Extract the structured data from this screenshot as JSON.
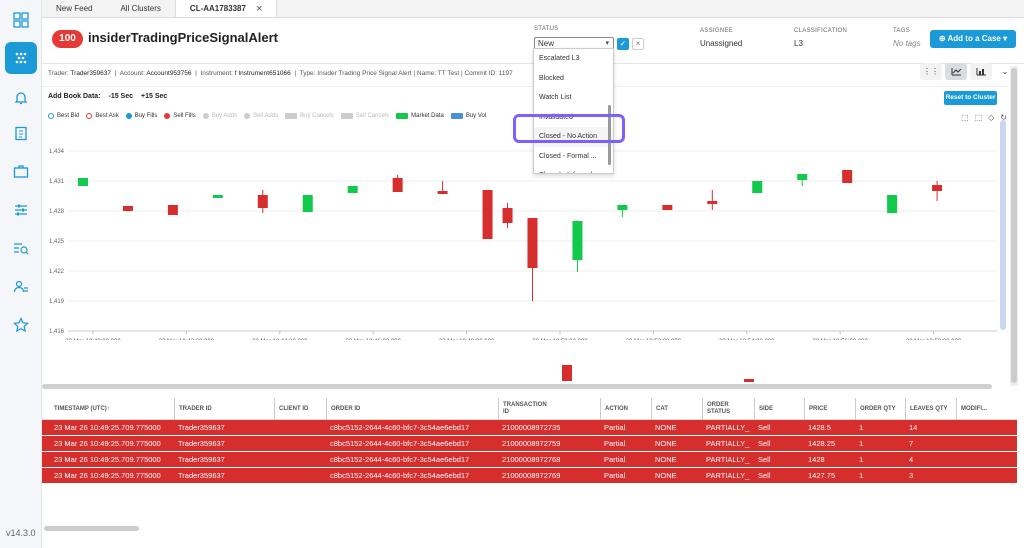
{
  "tabs": [
    {
      "label": "New Feed"
    },
    {
      "label": "All Clusters"
    },
    {
      "label": "CL-AA1783387"
    }
  ],
  "sidebar": {
    "version": "v14.3.0"
  },
  "header": {
    "score": "100",
    "title": "insiderTradingPriceSignalAlert",
    "status_label": "STATUS",
    "status_value": "New",
    "assignee_label": "ASSIGNEE",
    "assignee_value": "Unassigned",
    "classification_label": "CLASSIFICATION",
    "classification_value": "L3",
    "tags_label": "TAGS",
    "tags_value": "No tags",
    "add_case": "Add to a Case"
  },
  "status_dropdown": {
    "options": [
      "Escalated L3",
      "Blocked",
      "Watch List",
      "Invalidated",
      "Closed - No Action",
      "Closed - Formal ...",
      "Closed - Informal..."
    ],
    "highlighted": "Closed - No Action"
  },
  "info": {
    "trader_label": "Trader:",
    "trader": "Trader359637",
    "account_label": "Account:",
    "account": "Account953756",
    "instrument_label": "Instrument:",
    "instrument": "f Instrument651066",
    "rest": "Type: Insider Trading Price Signal Alert | Name: TT Test | Commit ID: 1197"
  },
  "chart_controls": {
    "book_label": "Add Book Data:",
    "minus": "-15 Sec",
    "plus": "+15 Sec",
    "reset": "Reset to Cluster"
  },
  "legend": [
    {
      "label": "Best Bid",
      "color": "#1a9ad6",
      "kind": "ring",
      "dim": false
    },
    {
      "label": "Best Ask",
      "color": "#e53935",
      "kind": "ring",
      "dim": false
    },
    {
      "label": "Buy Fills",
      "color": "#1a9ad6",
      "kind": "dot",
      "dim": false
    },
    {
      "label": "Sell Fills",
      "color": "#e53935",
      "kind": "dot",
      "dim": false
    },
    {
      "label": "Buy Adds",
      "color": "#cccccc",
      "kind": "dot",
      "dim": true
    },
    {
      "label": "Sell Adds",
      "color": "#cccccc",
      "kind": "dot",
      "dim": true
    },
    {
      "label": "Buy Cancels",
      "color": "#cccccc",
      "kind": "sw",
      "dim": true
    },
    {
      "label": "Sell Cancels",
      "color": "#cccccc",
      "kind": "sw",
      "dim": true
    },
    {
      "label": "Market Data",
      "color": "#13c94b",
      "kind": "sw",
      "dim": false
    },
    {
      "label": "Buy Vol",
      "color": "#4a90d9",
      "kind": "sw",
      "dim": false
    }
  ],
  "chart_data": {
    "type": "candlestick",
    "y_ticks": [
      1416,
      1419,
      1422,
      1425,
      1428,
      1431,
      1434
    ],
    "ylim": [
      1416,
      1436
    ],
    "x_ticks": [
      "23 Mar 10:40:00.000",
      "23 Mar 10:42:00.000",
      "23 Mar 10:44:00.000",
      "23 Mar 10:46:00.000",
      "23 Mar 10:48:00.000",
      "23 Mar 10:50:00.000",
      "23 Mar 10:52:00.000",
      "23 Mar 10:54:00.000",
      "23 Mar 10:56:00.000",
      "23 Mar 10:58:00.000"
    ],
    "candles": [
      {
        "t": 0.3,
        "o": 1430.5,
        "c": 1431.3,
        "h": 1431.3,
        "l": 1430.5
      },
      {
        "t": 1.2,
        "o": 1428.5,
        "c": 1428,
        "h": 1428.5,
        "l": 1428
      },
      {
        "t": 2.1,
        "o": 1428.6,
        "c": 1427.6,
        "h": 1428.6,
        "l": 1427.6
      },
      {
        "t": 3.0,
        "o": 1429.3,
        "c": 1429.6,
        "h": 1429.6,
        "l": 1429.3
      },
      {
        "t": 3.9,
        "o": 1429.6,
        "c": 1428.3,
        "h": 1430.1,
        "l": 1427.8
      },
      {
        "t": 4.8,
        "o": 1427.9,
        "c": 1429.6,
        "h": 1429.6,
        "l": 1427.9
      },
      {
        "t": 5.7,
        "o": 1429.8,
        "c": 1430.5,
        "h": 1430.5,
        "l": 1429.8
      },
      {
        "t": 6.6,
        "o": 1431.3,
        "c": 1429.9,
        "h": 1431.6,
        "l": 1429.9
      },
      {
        "t": 7.5,
        "o": 1430,
        "c": 1429.7,
        "h": 1431,
        "l": 1429.7
      },
      {
        "t": 8.4,
        "o": 1430.1,
        "c": 1425.2,
        "h": 1430.1,
        "l": 1425.2
      },
      {
        "t": 8.8,
        "o": 1428.3,
        "c": 1426.8,
        "h": 1428.8,
        "l": 1426.3
      },
      {
        "t": 9.3,
        "o": 1427.3,
        "c": 1422.3,
        "h": 1427.3,
        "l": 1419
      },
      {
        "t": 10.2,
        "o": 1423.1,
        "c": 1427,
        "h": 1427,
        "l": 1421.9
      },
      {
        "t": 11.1,
        "o": 1428.1,
        "c": 1428.6,
        "h": 1428.6,
        "l": 1427.4
      },
      {
        "t": 12.0,
        "o": 1428.6,
        "c": 1428.1,
        "h": 1428.6,
        "l": 1428.1
      },
      {
        "t": 12.9,
        "o": 1429,
        "c": 1428.7,
        "h": 1430.1,
        "l": 1428.1
      },
      {
        "t": 13.8,
        "o": 1429.8,
        "c": 1431,
        "h": 1431,
        "l": 1429.8
      },
      {
        "t": 14.7,
        "o": 1431.1,
        "c": 1431.7,
        "h": 1431.7,
        "l": 1430.5
      },
      {
        "t": 15.6,
        "o": 1432.1,
        "c": 1430.8,
        "h": 1432.1,
        "l": 1430.8
      },
      {
        "t": 16.5,
        "o": 1427.8,
        "c": 1429.6,
        "h": 1429.6,
        "l": 1427.8
      },
      {
        "t": 17.4,
        "o": 1430.6,
        "c": 1430,
        "h": 1431,
        "l": 1429
      }
    ]
  },
  "table": {
    "columns": [
      "TIMESTAMP (UTC)",
      "TRADER ID",
      "CLIENT ID",
      "ORDER ID",
      "TRANSACTION ID",
      "ACTION",
      "CAT",
      "ORDER STATUS",
      "SIDE",
      "PRICE",
      "ORDER QTY",
      "LEAVES QTY",
      "MODIFI..."
    ],
    "rows": [
      [
        "23 Mar 26 10:49:25.709.775000",
        "Trader359637",
        "",
        "c8bc5152-2644-4c60-bfc7-3c54ae6ebd17",
        "21000008972735",
        "Partial",
        "NONE",
        "PARTIALLY_",
        "Sell",
        "1428.5",
        "1",
        "14",
        ""
      ],
      [
        "23 Mar 26 10:49:25.709.775000",
        "Trader359637",
        "",
        "c8bc5152-2644-4c60-bfc7-3c54ae6ebd17",
        "21000008972759",
        "Partial",
        "NONE",
        "PARTIALLY_",
        "Sell",
        "1428.25",
        "1",
        "7",
        ""
      ],
      [
        "23 Mar 26 10:49:25.709.775000",
        "Trader359637",
        "",
        "c8bc5152-2644-4c60-bfc7-3c54ae6ebd17",
        "21000008972768",
        "Partial",
        "NONE",
        "PARTIALLY_",
        "Sell",
        "1428",
        "1",
        "4",
        ""
      ],
      [
        "23 Mar 26 10:49:25.709.775000",
        "Trader359637",
        "",
        "c8bc5152-2644-4c60-bfc7-3c54ae6ebd17",
        "21000008972769",
        "Partial",
        "NONE",
        "PARTIALLY_",
        "Sell",
        "1427.75",
        "1",
        "3",
        ""
      ]
    ]
  }
}
